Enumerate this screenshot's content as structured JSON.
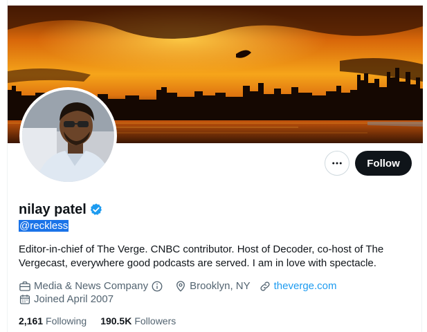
{
  "profile": {
    "display_name": "nilay patel",
    "handle": "@reckless",
    "bio": "Editor-in-chief of The Verge. CNBC contributor. Host of Decoder, co-host of The Vergecast, everywhere good podcasts are served. I am in love with spectacle.",
    "category": "Media & News Company",
    "location": "Brooklyn, NY",
    "website": "theverge.com",
    "joined": "Joined April 2007",
    "following_count": "2,161",
    "following_label": "Following",
    "followers_count": "190.5K",
    "followers_label": "Followers"
  },
  "actions": {
    "follow_label": "Follow",
    "more_icon": "more-horizontal-icon"
  },
  "icons": {
    "verified": "verified-badge-icon",
    "category": "briefcase-icon",
    "info": "info-icon",
    "location": "location-pin-icon",
    "link": "link-icon",
    "calendar": "calendar-icon"
  },
  "colors": {
    "accent": "#1d9bf0",
    "text_primary": "#0f1419",
    "text_secondary": "#536471",
    "follow_bg": "#0f1419",
    "selection": "#1a73e8"
  }
}
